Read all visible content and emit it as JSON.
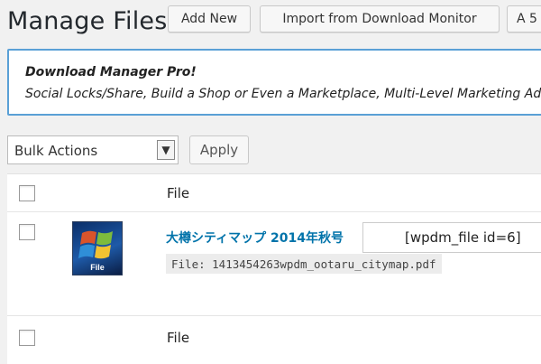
{
  "header": {
    "title": "Manage Files",
    "buttons": {
      "add_new": "Add New",
      "import": "Import from Download Monitor",
      "a_button": "A 5"
    }
  },
  "notice": {
    "title": "Download Manager Pro!",
    "text": "Social Locks/Share, Build a Shop or Even a Marketplace, Multi-Level Marketing Add-"
  },
  "bulk": {
    "selected": "Bulk Actions",
    "apply_label": "Apply"
  },
  "table": {
    "column_header": "File",
    "footer_header": "File",
    "rows": [
      {
        "title": "大樽シティマップ 2014年秋号",
        "shortcode": "[wpdm_file id=6]",
        "file_path": "File: 1413454263wpdm_ootaru_citymap.pdf",
        "thumb_label": "File"
      }
    ]
  },
  "colors": {
    "link": "#0073aa",
    "notice_border": "#5aa0d6",
    "background": "#f1f1f1"
  },
  "icons": [
    "checkbox-icon",
    "dropdown-arrow-icon",
    "file-thumbnail-icon"
  ]
}
